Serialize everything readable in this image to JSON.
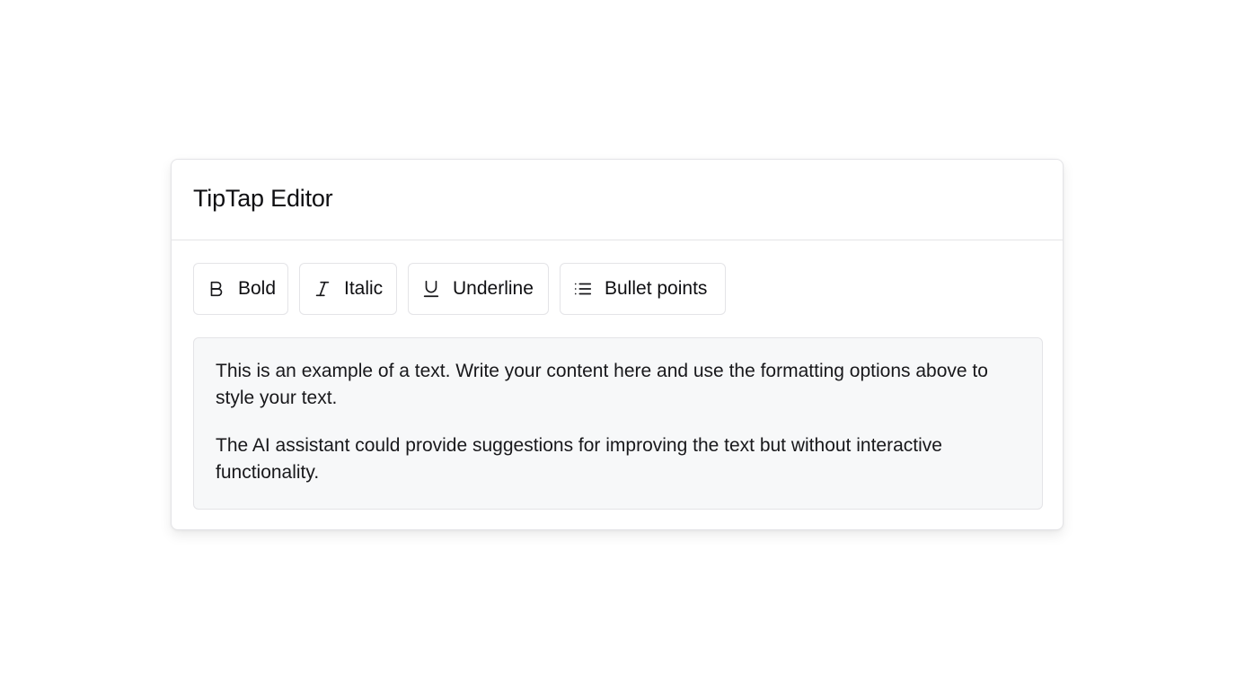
{
  "card": {
    "title": "TipTap Editor"
  },
  "toolbar": {
    "buttons": [
      {
        "label": "Bold",
        "icon": "bold-icon"
      },
      {
        "label": "Italic",
        "icon": "italic-icon"
      },
      {
        "label": "Underline",
        "icon": "underline-icon"
      },
      {
        "label": "Bullet points",
        "icon": "list-icon"
      }
    ]
  },
  "editor": {
    "paragraphs": [
      "This is an example of a text. Write your content here and use the formatting options above to style your text.",
      "The AI assistant could provide suggestions for improving the text but without interactive functionality."
    ]
  },
  "colors": {
    "border": "#e4e4e7",
    "editor_background": "#f7f8f9",
    "text": "#0f0f12"
  }
}
